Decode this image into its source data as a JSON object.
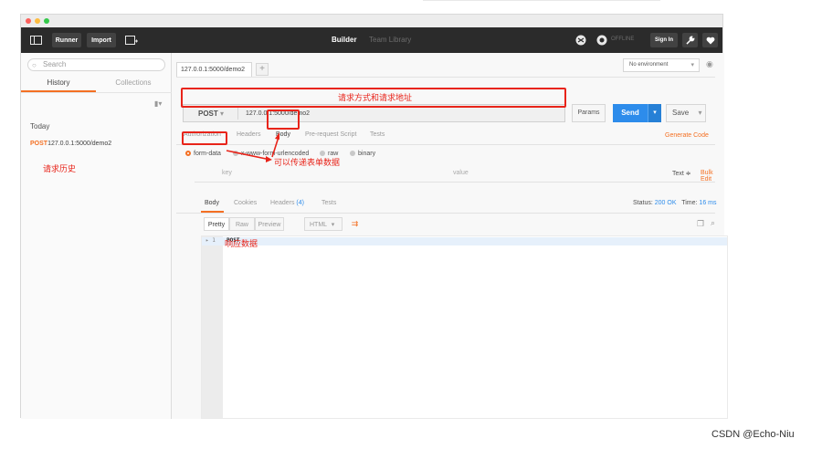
{
  "toolbar": {
    "runner": "Runner",
    "import": "Import",
    "builder": "Builder",
    "team_library": "Team Library",
    "offline": "OFFLINE",
    "sign_in": "Sign In"
  },
  "sidebar": {
    "search_placeholder": "Search",
    "tabs": [
      "History",
      "Collections"
    ],
    "group": "Today",
    "items": [
      {
        "method": "POST",
        "url": "127.0.0.1:5000/demo2"
      }
    ]
  },
  "request": {
    "tab_label": "127.0.0.1:5000/demo2",
    "environment": "No environment",
    "method": "POST",
    "url": "127.0.0.1:5000/demo2",
    "params": "Params",
    "send": "Send",
    "save": "Save",
    "subtabs": [
      "Authorization",
      "Headers",
      "Body",
      "Pre-request Script",
      "Tests"
    ],
    "generate_code": "Generate Code",
    "body_modes": [
      "form-data",
      "x-www-form-urlencoded",
      "raw",
      "binary"
    ],
    "key_placeholder": "key",
    "value_placeholder": "value",
    "text_toggle": "Text ≑",
    "bulk_edit": "Bulk Edit"
  },
  "response": {
    "tabs": [
      "Body",
      "Cookies",
      "Headers",
      "(4)",
      "Tests"
    ],
    "status_label": "Status:",
    "status_value": "200 OK",
    "time_label": "Time:",
    "time_value": "16 ms",
    "formats": [
      "Pretty",
      "Raw",
      "Preview"
    ],
    "format_select": "HTML",
    "line_number": "1",
    "body": "POST"
  },
  "annotations": {
    "method_url": "请求方式和请求地址",
    "form_data": "可以传递表单数据",
    "history": "请求历史",
    "response": "响应数据"
  },
  "watermark": "CSDN @Echo-Niu",
  "colors": {
    "accent": "#f47023",
    "send": "#2d8ceb",
    "annotation": "#e8241a",
    "toolbar": "#2b2b2b"
  }
}
